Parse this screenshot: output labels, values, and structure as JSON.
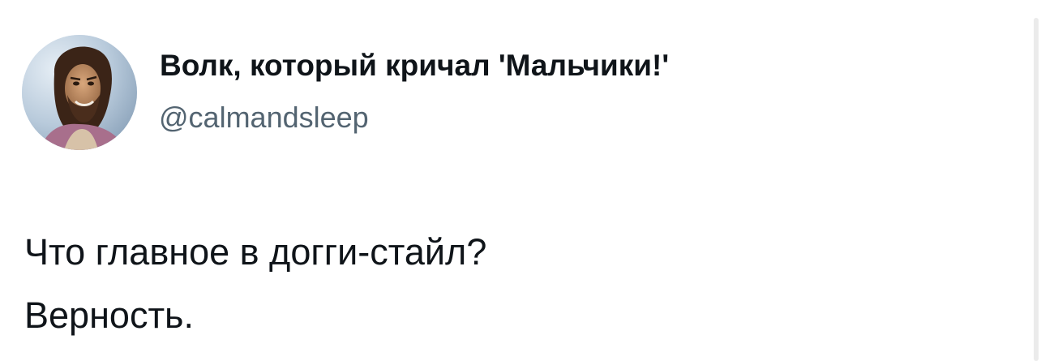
{
  "tweet": {
    "author": {
      "display_name": "Волк, который кричал 'Мальчики!'",
      "handle": "@calmandsleep",
      "avatar_icon": "profile-painting-avatar"
    },
    "text_lines": [
      "Что главное в догги-стайл?",
      "Верность."
    ]
  },
  "colors": {
    "text_primary": "#0f1419",
    "text_secondary": "#536471",
    "background": "#ffffff"
  }
}
